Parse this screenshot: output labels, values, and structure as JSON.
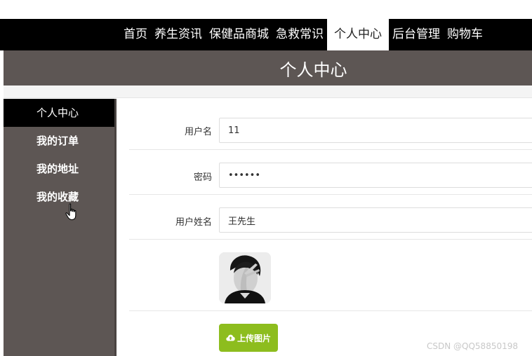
{
  "nav": {
    "items": [
      {
        "label": "首页"
      },
      {
        "label": "养生资讯"
      },
      {
        "label": "保健品商城"
      },
      {
        "label": "急救常识"
      },
      {
        "label": "个人中心",
        "active": true
      },
      {
        "label": "后台管理"
      },
      {
        "label": "购物车"
      }
    ]
  },
  "banner": {
    "title": "个人中心"
  },
  "sidebar": {
    "items": [
      {
        "label": "个人中心",
        "active": true
      },
      {
        "label": "我的订单"
      },
      {
        "label": "我的地址"
      },
      {
        "label": "我的收藏"
      }
    ]
  },
  "form": {
    "username": {
      "label": "用户名",
      "value": "11"
    },
    "password": {
      "label": "密码",
      "value": "••••••"
    },
    "realname": {
      "label": "用户姓名",
      "value": "王先生"
    },
    "upload": {
      "label": "上传图片",
      "icon": "cloud-upload-icon"
    }
  },
  "colors": {
    "nav_bg": "#000000",
    "banner_bg": "#5d5654",
    "sidebar_bg": "#5d5654",
    "upload_btn": "#8dbd1e"
  },
  "watermark": "CSDN @QQ58850198"
}
